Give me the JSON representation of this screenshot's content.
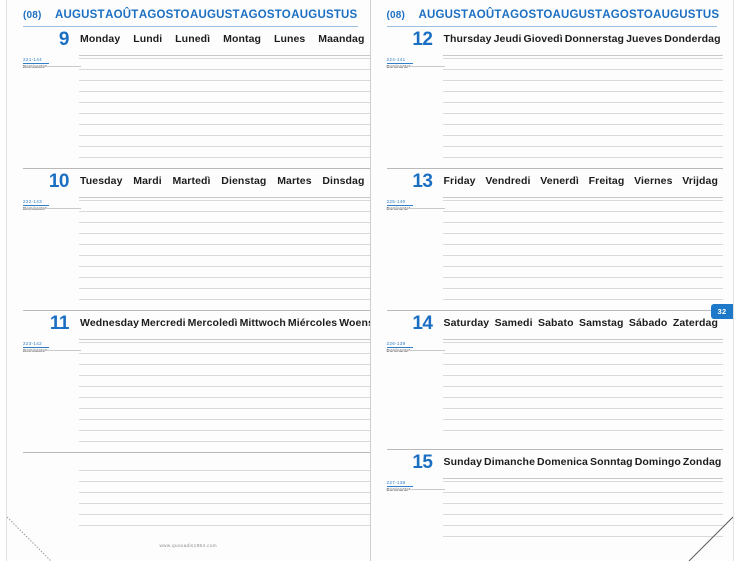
{
  "meta": {
    "accent_blue": "#1b6fc3",
    "tab_blue": "#1e7ac8",
    "rule_gray": "#d9d9d9",
    "footer_url": "www.quovadis1954.com"
  },
  "header": {
    "month_code": "(08)",
    "month_names": [
      "AUGUST",
      "AOÛT",
      "AGOSTO",
      "AUGUST",
      "AGOSTO",
      "AUGUSTUS"
    ]
  },
  "month_tab": {
    "label": "32"
  },
  "left_page": {
    "days": [
      {
        "number": "9",
        "day_names": [
          "Monday",
          "Lundi",
          "Lunedì",
          "Montag",
          "Lunes",
          "Maandag"
        ],
        "doy_number": "221-144",
        "doy_label": "Dominante*"
      },
      {
        "number": "10",
        "day_names": [
          "Tuesday",
          "Mardi",
          "Martedì",
          "Dienstag",
          "Martes",
          "Dinsdag"
        ],
        "doy_number": "222-143",
        "doy_label": "Dominante*"
      },
      {
        "number": "11",
        "day_names": [
          "Wednesday",
          "Mercredi",
          "Mercoledì",
          "Mittwoch",
          "Miércoles",
          "Woensdag"
        ],
        "doy_number": "223-142",
        "doy_label": "Dominante*"
      }
    ]
  },
  "right_page": {
    "days": [
      {
        "number": "12",
        "day_names": [
          "Thursday",
          "Jeudi",
          "Giovedì",
          "Donnerstag",
          "Jueves",
          "Donderdag"
        ],
        "doy_number": "224-141",
        "doy_label": "Dominante*"
      },
      {
        "number": "13",
        "day_names": [
          "Friday",
          "Vendredi",
          "Venerdì",
          "Freitag",
          "Viernes",
          "Vrijdag"
        ],
        "doy_number": "225-140",
        "doy_label": "Dominante*"
      },
      {
        "number": "14",
        "day_names": [
          "Saturday",
          "Samedi",
          "Sabato",
          "Samstag",
          "Sábado",
          "Zaterdag"
        ],
        "doy_number": "226-139",
        "doy_label": "Dominante*"
      },
      {
        "number": "15",
        "day_names": [
          "Sunday",
          "Dimanche",
          "Domenica",
          "Sonntag",
          "Domingo",
          "Zondag"
        ],
        "doy_number": "227-138",
        "doy_label": "Dominante*"
      }
    ]
  }
}
